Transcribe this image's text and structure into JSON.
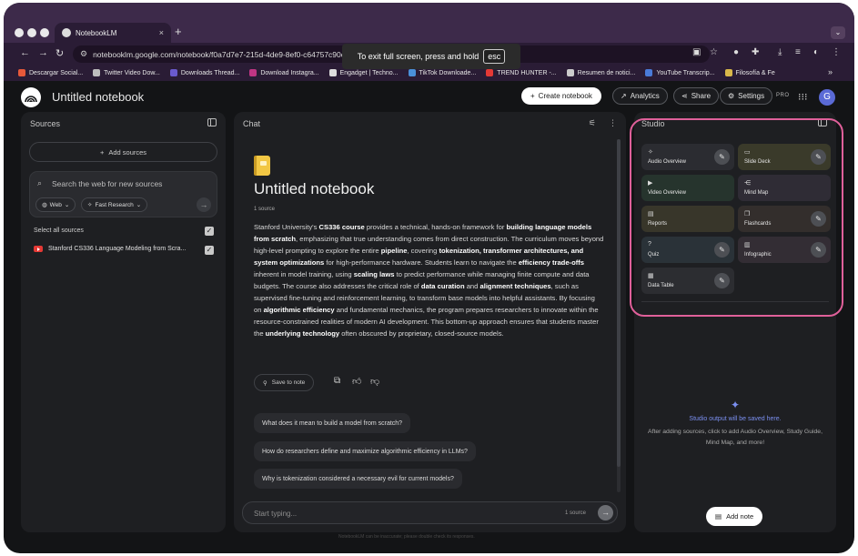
{
  "browser": {
    "tab_title": "NotebookLM",
    "tab_close": "×",
    "new_tab": "+",
    "url": "notebooklm.google.com/notebook/f0a7d7e7-215d-4de9-8ef0-c64757c90cfc",
    "fullscreen_msg": "To exit full screen, press and hold",
    "fullscreen_key": "esc",
    "bookmarks": [
      {
        "label": "Descargar Social...",
        "color": "#e8593a"
      },
      {
        "label": "Twitter Video Dow...",
        "color": "#bdbdbd"
      },
      {
        "label": "Downloads Thread...",
        "color": "#6a5acd"
      },
      {
        "label": "Download Instagra...",
        "color": "#c13584"
      },
      {
        "label": "Engadget | Techno...",
        "color": "#dddddd"
      },
      {
        "label": "TikTok Downloade...",
        "color": "#4a90d9"
      },
      {
        "label": "TREND HUNTER -...",
        "color": "#e53935"
      },
      {
        "label": "Resumen de notici...",
        "color": "#cccccc"
      },
      {
        "label": "YouTube Transcrip...",
        "color": "#4a7bd9"
      },
      {
        "label": "Filosofía & Fe",
        "color": "#d9b84a"
      }
    ],
    "bookmarks_more": "»"
  },
  "header": {
    "title": "Untitled notebook",
    "create_label": "Create notebook",
    "analytics_label": "Analytics",
    "share_label": "Share",
    "settings_label": "Settings",
    "pro_label": "PRO",
    "avatar_letter": "G"
  },
  "sources": {
    "title": "Sources",
    "add_label": "Add sources",
    "search_placeholder": "Search the web for new sources",
    "chip_web": "Web",
    "chip_research": "Fast Research",
    "select_all": "Select all sources",
    "items": [
      {
        "label": "Stanford CS336 Language Modeling from Scra...",
        "checked": true
      }
    ]
  },
  "chat": {
    "title": "Chat",
    "notebook_title": "Untitled notebook",
    "source_count": "1 source",
    "save_to_note": "Save to note",
    "suggestions": [
      "What does it mean to build a model from scratch?",
      "How do researchers define and maximize algorithmic efficiency in LLMs?",
      "Why is tokenization considered a necessary evil for current models?"
    ],
    "input_placeholder": "Start typing...",
    "input_source_count": "1 source",
    "footer": "NotebookLM can be inaccurate; please double check its responses."
  },
  "summary_segments": [
    {
      "t": "Stanford University's ",
      "b": false
    },
    {
      "t": "CS336 course",
      "b": true
    },
    {
      "t": " provides a technical, hands-on framework for ",
      "b": false
    },
    {
      "t": "building language models from scratch",
      "b": true
    },
    {
      "t": ", emphasizing that true understanding comes from direct construction. The curriculum moves beyond high-level prompting to explore the entire ",
      "b": false
    },
    {
      "t": "pipeline",
      "b": true
    },
    {
      "t": ", covering ",
      "b": false
    },
    {
      "t": "tokenization, transformer architectures, and system optimizations",
      "b": true
    },
    {
      "t": " for high-performance hardware. Students learn to navigate the ",
      "b": false
    },
    {
      "t": "efficiency trade-offs",
      "b": true
    },
    {
      "t": " inherent in model training, using ",
      "b": false
    },
    {
      "t": "scaling laws",
      "b": true
    },
    {
      "t": " to predict performance while managing finite compute and data budgets. The course also addresses the critical role of ",
      "b": false
    },
    {
      "t": "data curation",
      "b": true
    },
    {
      "t": " and ",
      "b": false
    },
    {
      "t": "alignment techniques",
      "b": true
    },
    {
      "t": ", such as supervised fine-tuning and reinforcement learning, to transform base models into helpful assistants. By focusing on ",
      "b": false
    },
    {
      "t": "algorithmic efficiency",
      "b": true
    },
    {
      "t": " and fundamental mechanics, the program prepares researchers to innovate within the resource-constrained realities of modern AI development. This bottom-up approach ensures that students master the ",
      "b": false
    },
    {
      "t": "underlying technology",
      "b": true
    },
    {
      "t": " often obscured by proprietary, closed-source models.",
      "b": false
    }
  ],
  "studio": {
    "title": "Studio",
    "tiles": [
      {
        "label": "Audio Overview",
        "icon": "audio-icon",
        "glyph": "✧",
        "color": "#2b2c31",
        "editable": true
      },
      {
        "label": "Slide Deck",
        "icon": "slides-icon",
        "glyph": "▭",
        "color": "#3a3a2a",
        "editable": true
      },
      {
        "label": "Video Overview",
        "icon": "video-icon",
        "glyph": "▶",
        "color": "#26342d",
        "editable": false
      },
      {
        "label": "Mind Map",
        "icon": "mindmap-icon",
        "glyph": "⋲",
        "color": "#2f2c35",
        "editable": false
      },
      {
        "label": "Reports",
        "icon": "reports-icon",
        "glyph": "▤",
        "color": "#38362a",
        "editable": false
      },
      {
        "label": "Flashcards",
        "icon": "flashcards-icon",
        "glyph": "❐",
        "color": "#332e2c",
        "editable": true
      },
      {
        "label": "Quiz",
        "icon": "quiz-icon",
        "glyph": "?",
        "color": "#2a3238",
        "editable": true
      },
      {
        "label": "Infographic",
        "icon": "infographic-icon",
        "glyph": "▥",
        "color": "#332d34",
        "editable": true
      },
      {
        "label": "Data Table",
        "icon": "table-icon",
        "glyph": "▦",
        "color": "#2c2d31",
        "editable": true
      }
    ],
    "empty_title": "Studio output will be saved here.",
    "empty_text": "After adding sources, click to add Audio Overview, Study Guide, Mind Map, and more!",
    "add_note": "Add note"
  },
  "colors": {
    "highlight": "#e0609a",
    "accent_blue": "#7b8ff0",
    "chrome_purple": "#3d2a4a"
  }
}
